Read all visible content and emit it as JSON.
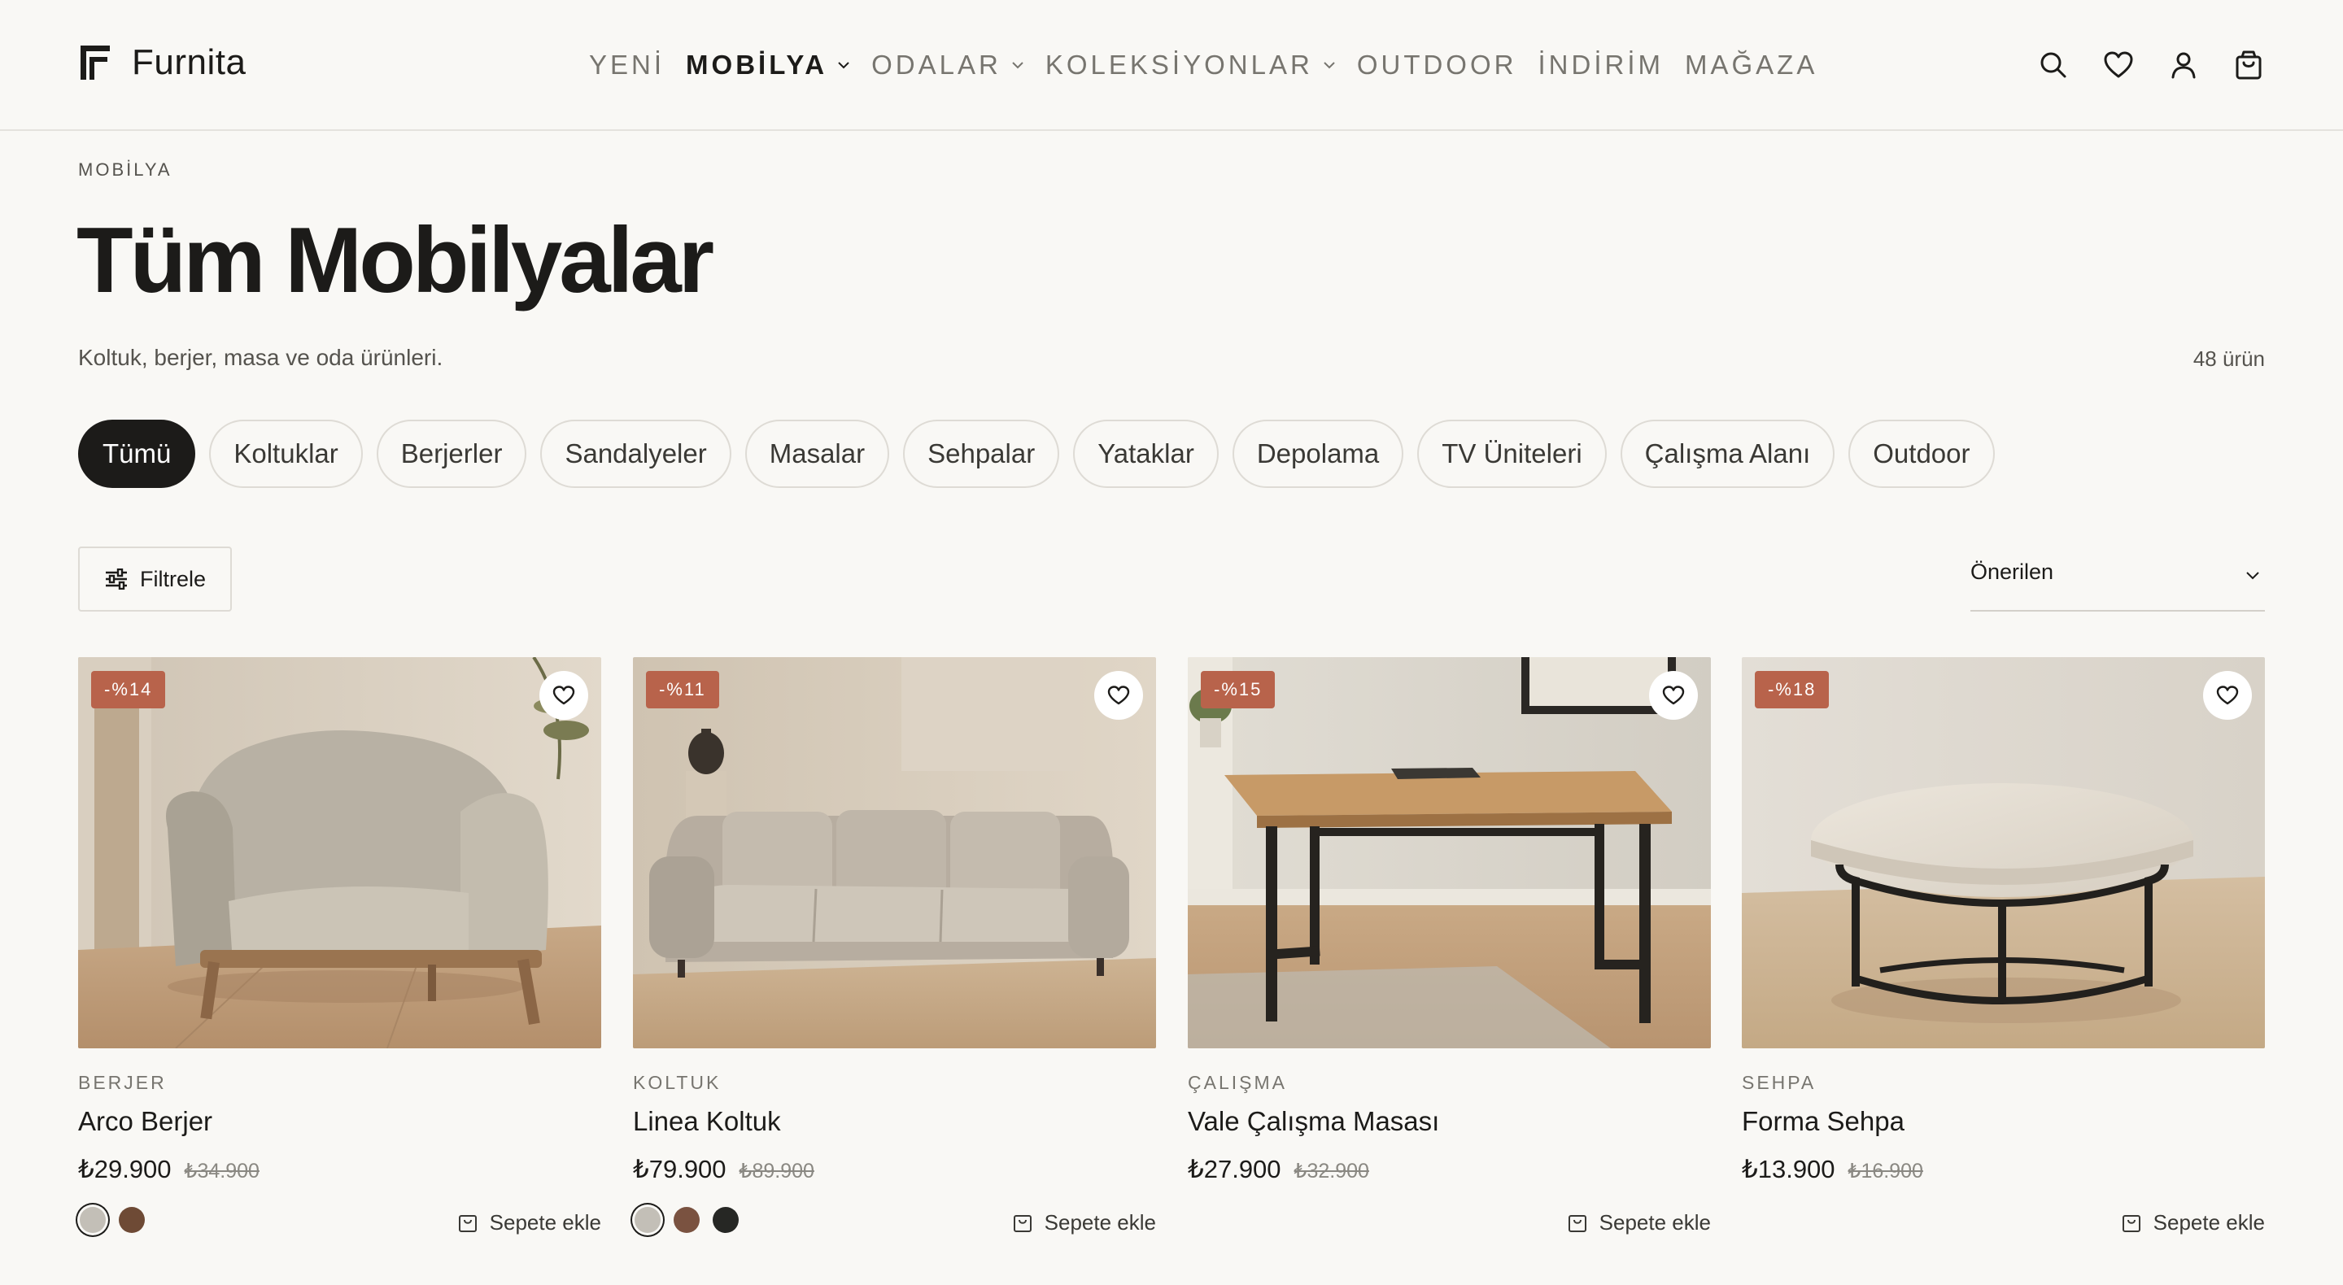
{
  "brand": {
    "name": "Furnita"
  },
  "nav": {
    "items": [
      {
        "label": "YENİ"
      },
      {
        "label": "MOBİLYA"
      },
      {
        "label": "ODALAR"
      },
      {
        "label": "KOLEKSİYONLAR"
      },
      {
        "label": "OUTDOOR"
      },
      {
        "label": "İNDİRİM"
      },
      {
        "label": "MAĞAZA"
      }
    ],
    "active": "MOBİLYA"
  },
  "header_icons": [
    "search-icon",
    "heart-icon",
    "user-icon",
    "bag-icon"
  ],
  "page": {
    "breadcrumb": "MOBİLYA",
    "title": "Tüm Mobilyalar",
    "subtitle": "Koltuk, berjer, masa ve oda ürünleri.",
    "count": "48 ürün"
  },
  "categories": [
    "Tümü",
    "Koltuklar",
    "Berjerler",
    "Sandalyeler",
    "Masalar",
    "Sehpalar",
    "Yataklar",
    "Depolama",
    "TV Üniteleri",
    "Çalışma Alanı",
    "Outdoor"
  ],
  "active_category": "Tümü",
  "toolbar": {
    "filter_label": "Filtrele",
    "sort_label": "Önerilen"
  },
  "products": [
    {
      "badge": "-%14",
      "category": "BERJER",
      "name": "Arco Berjer",
      "price": "₺29.900",
      "old_price": "₺34.900",
      "swatches": [
        "#c3bfb7",
        "#6e4a35"
      ],
      "add_label": "Sepete ekle"
    },
    {
      "badge": "-%11",
      "category": "KOLTUK",
      "name": "Linea Koltuk",
      "price": "₺79.900",
      "old_price": "₺89.900",
      "swatches": [
        "#c3bfb7",
        "#7a5240",
        "#262724"
      ],
      "add_label": "Sepete ekle"
    },
    {
      "badge": "-%15",
      "category": "ÇALIŞMA",
      "name": "Vale Çalışma Masası",
      "price": "₺27.900",
      "old_price": "₺32.900",
      "swatches": [],
      "add_label": "Sepete ekle"
    },
    {
      "badge": "-%18",
      "category": "SEHPA",
      "name": "Forma Sehpa",
      "price": "₺13.900",
      "old_price": "₺16.900",
      "swatches": [],
      "add_label": "Sepete ekle"
    }
  ],
  "colors": {
    "accent": "#b8634b",
    "ink": "#1c1b19",
    "background": "#f9f8f5"
  }
}
